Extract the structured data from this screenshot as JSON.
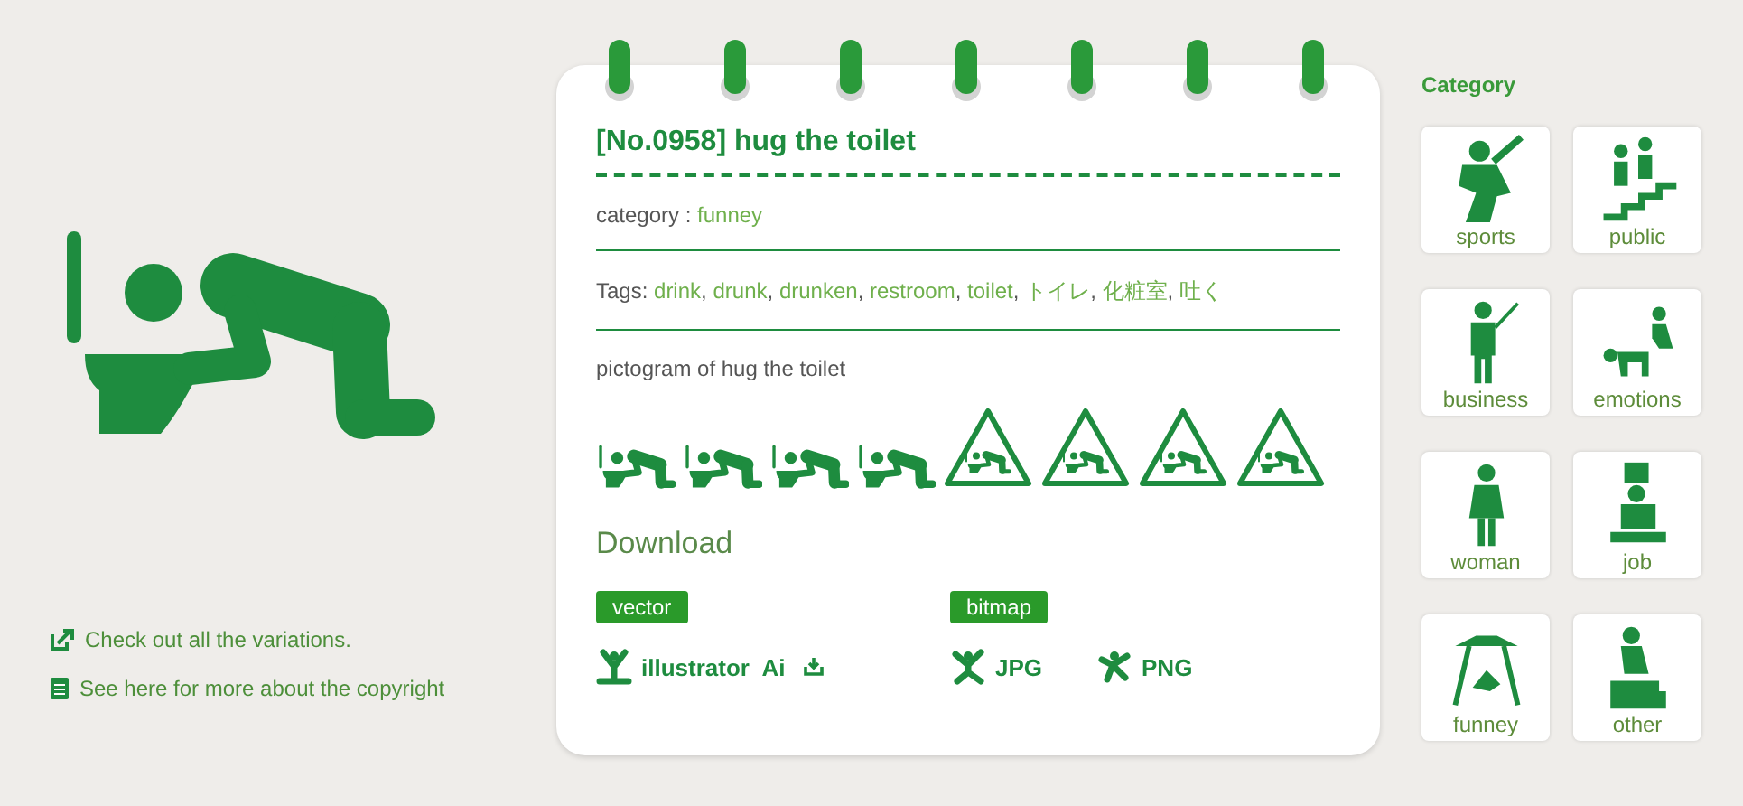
{
  "side_links": [
    {
      "kind": "external",
      "label": "Check out all the variations."
    },
    {
      "kind": "document",
      "label": "See here for more about the copyright"
    }
  ],
  "card": {
    "title": "[No.0958] hug the toilet",
    "category_label": "category : ",
    "category_value": "funney",
    "tags_label": "Tags: ",
    "tag_separator": ",",
    "tags": [
      "drink",
      "drunk",
      "drunken",
      "restroom",
      "toilet",
      "トイレ",
      "化粧室",
      "吐く"
    ],
    "description": "pictogram of hug the toilet",
    "variations": [
      {
        "kind": "plain"
      },
      {
        "kind": "plain"
      },
      {
        "kind": "plain"
      },
      {
        "kind": "plain"
      },
      {
        "kind": "warning"
      },
      {
        "kind": "warning"
      },
      {
        "kind": "warning"
      },
      {
        "kind": "warning"
      }
    ],
    "download_heading": "Download",
    "groups": [
      {
        "badge": "vector",
        "files": [
          {
            "kind": "ai",
            "label": "illustrator  Ai"
          }
        ]
      },
      {
        "badge": "bitmap",
        "files": [
          {
            "kind": "jpg",
            "label": "JPG"
          },
          {
            "kind": "png",
            "label": "PNG"
          }
        ]
      }
    ]
  },
  "sidebar": {
    "heading": "Category",
    "items": [
      {
        "label": "sports"
      },
      {
        "label": "public"
      },
      {
        "label": "business"
      },
      {
        "label": "emotions"
      },
      {
        "label": "woman"
      },
      {
        "label": "job"
      },
      {
        "label": "funney"
      },
      {
        "label": "other"
      }
    ]
  }
}
